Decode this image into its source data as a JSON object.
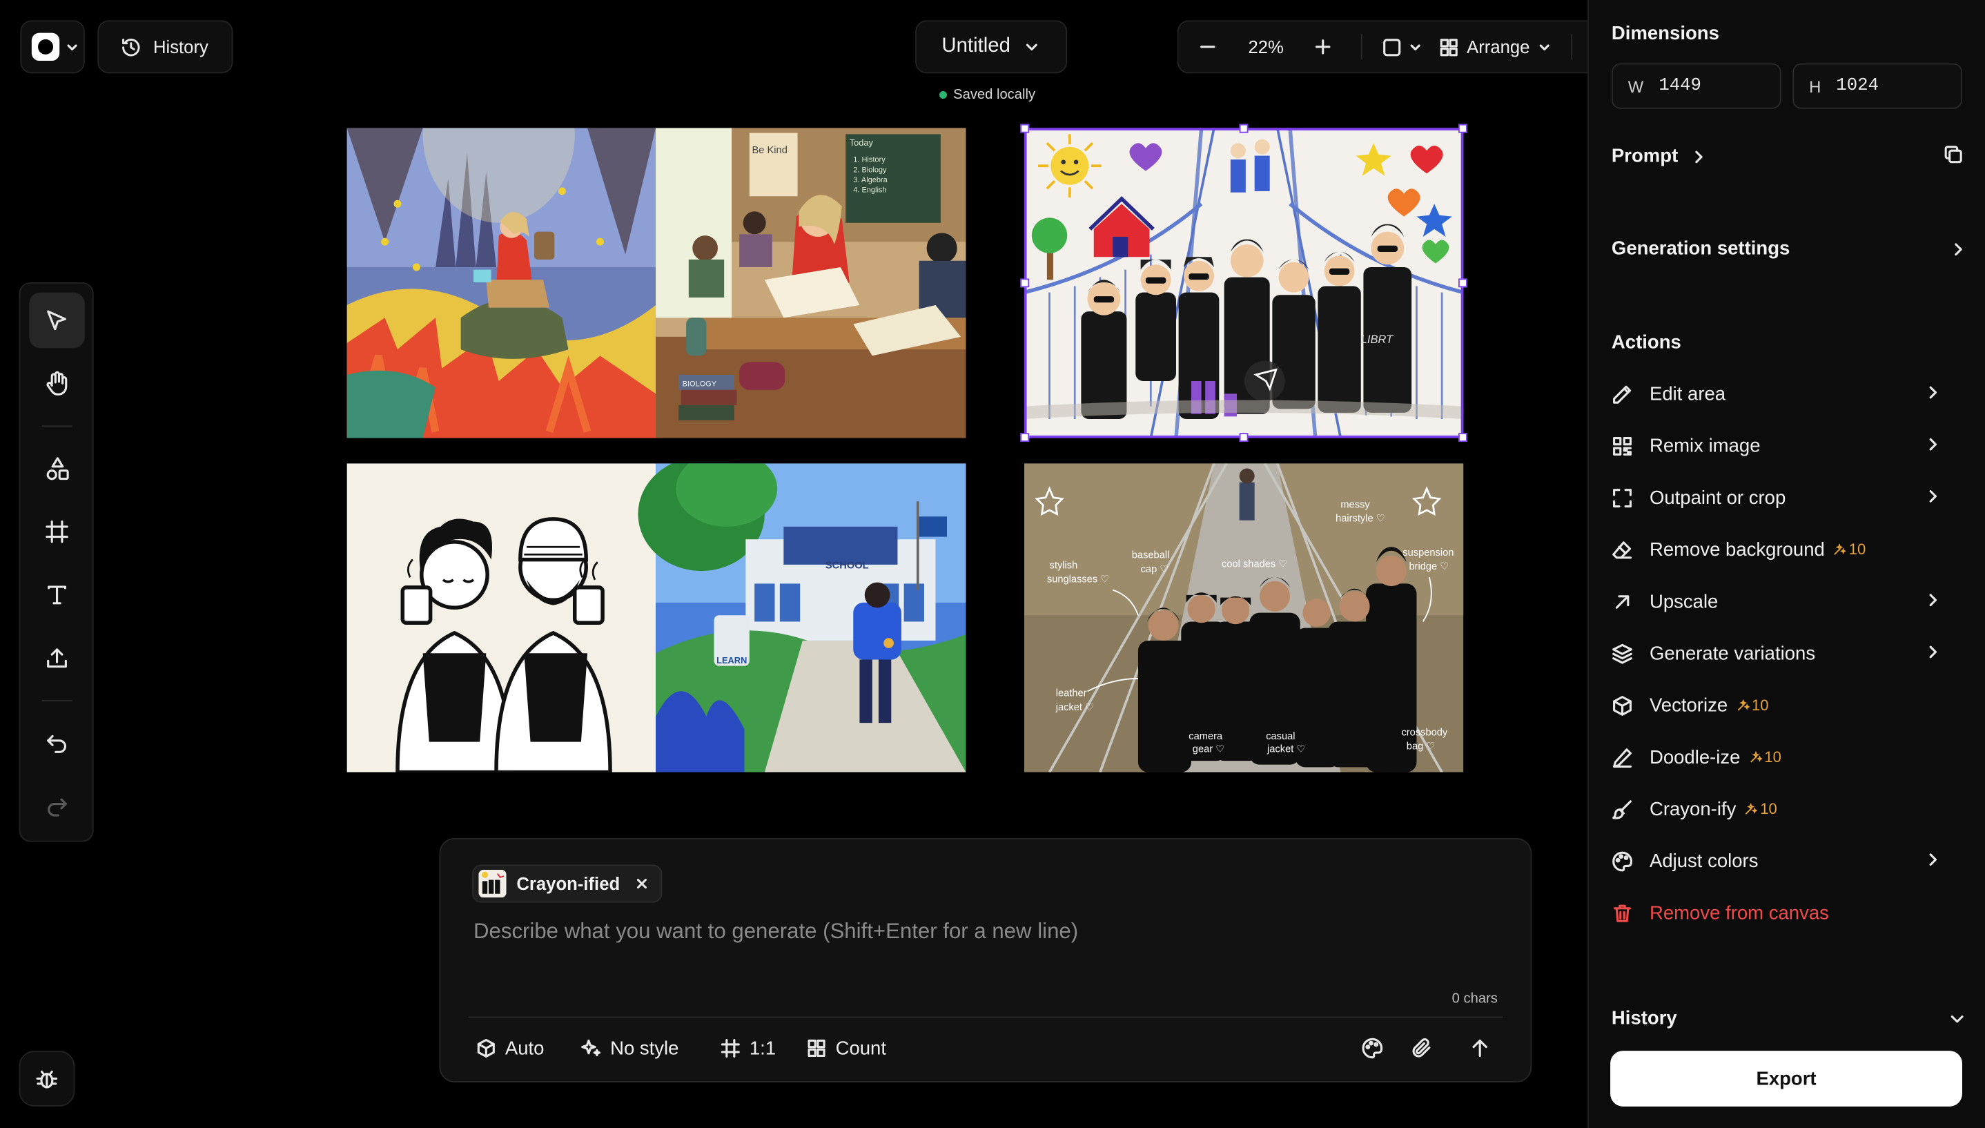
{
  "header": {
    "history_label": "History",
    "title": "Untitled",
    "saved_status": "Saved locally"
  },
  "zoom": {
    "level": "22%",
    "arrange_label": "Arrange"
  },
  "tools": [
    "select-tool",
    "pan-tool",
    "shapes-tool",
    "frame-tool",
    "text-tool",
    "upload-tool",
    "undo",
    "redo"
  ],
  "canvas": {
    "images": [
      {
        "name": "student-underwater-illustration",
        "labels": [
          "Be Kind",
          "Today",
          "1. History",
          "2. Biology",
          "3. Algebra",
          "4. English",
          "BIOLOGY"
        ]
      },
      {
        "name": "crayon-group-on-bridge",
        "labels": [
          "LIBRT"
        ]
      },
      {
        "name": "baristas-and-school-illustration",
        "labels": [
          "SCHOOL",
          "LEARN"
        ]
      },
      {
        "name": "annotated-group-photo",
        "labels": [
          "stylish sunglasses ♡",
          "baseball cap ♡",
          "cool shades ♡",
          "messy hairstyle ♡",
          "suspension bridge ♡",
          "leather jacket ♡",
          "camera gear ♡",
          "casual jacket ♡",
          "crossbody bag ♡"
        ]
      }
    ]
  },
  "prompt": {
    "chip_label": "Crayon-ified",
    "placeholder": "Describe what you want to generate (Shift+Enter for a new line)",
    "char_count": "0 chars",
    "auto_label": "Auto",
    "style_label": "No style",
    "ratio_label": "1:1",
    "count_label": "Count"
  },
  "panel": {
    "dimensions_title": "Dimensions",
    "width_label": "W",
    "width_value": "1449",
    "height_label": "H",
    "height_value": "1024",
    "prompt_title": "Prompt",
    "generation_title": "Generation settings",
    "actions_title": "Actions",
    "actions": [
      {
        "label": "Edit area",
        "icon": "pencil-icon"
      },
      {
        "label": "Remix image",
        "icon": "remix-icon"
      },
      {
        "label": "Outpaint or crop",
        "icon": "crop-icon"
      },
      {
        "label": "Remove background",
        "icon": "eraser-icon",
        "credits": "10"
      },
      {
        "label": "Upscale",
        "icon": "upscale-arrow-icon"
      },
      {
        "label": "Generate variations",
        "icon": "layers-icon"
      },
      {
        "label": "Vectorize",
        "icon": "cube-icon",
        "credits": "10"
      },
      {
        "label": "Doodle-ize",
        "icon": "pen-icon",
        "credits": "10"
      },
      {
        "label": "Crayon-ify",
        "icon": "brush-icon",
        "credits": "10"
      },
      {
        "label": "Adjust colors",
        "icon": "palette-icon"
      },
      {
        "label": "Remove from canvas",
        "icon": "trash-icon"
      }
    ],
    "history_title": "History",
    "export_label": "Export"
  },
  "colors": {
    "selection": "#7b3df0",
    "danger": "#f04a4a",
    "credit": "#e8a33a",
    "saved_dot": "#2bb673"
  }
}
